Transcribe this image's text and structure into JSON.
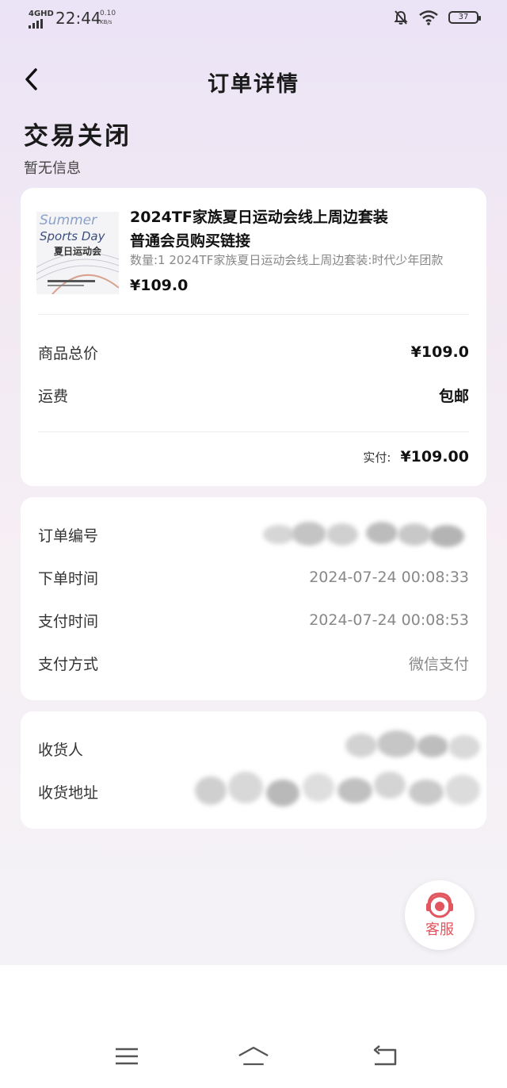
{
  "status_bar": {
    "network": "4GHD",
    "time": "22:44",
    "speed_value": "0.10",
    "speed_unit": "KB/s",
    "battery": "37",
    "icons": [
      "mute-bell-icon",
      "wifi-icon",
      "battery-icon"
    ]
  },
  "nav": {
    "title": "订单详情",
    "back_icon": "chevron-left-icon"
  },
  "order_status": {
    "title": "交易关闭",
    "subtitle": "暂无信息"
  },
  "goods": {
    "title_line1": "2024TF家族夏日运动会线上周边套装",
    "title_line2": "普通会员购买链接",
    "spec": "数量:1 2024TF家族夏日运动会线上周边套装:时代少年团款",
    "price": "¥109.0",
    "thumbnail_text": "Summer Sports Day",
    "thumbnail_subtext": "夏日运动会"
  },
  "price_summary": {
    "total_label": "商品总价",
    "total_value": "¥109.0",
    "shipping_label": "运费",
    "shipping_value": "包邮",
    "paid_label": "实付:",
    "paid_value": "¥109.00"
  },
  "order_info": {
    "number_label": "订单编号",
    "created_label": "下单时间",
    "created_value": "2024-07-24 00:08:33",
    "paid_time_label": "支付时间",
    "paid_time_value": "2024-07-24 00:08:53",
    "method_label": "支付方式",
    "method_value": "微信支付"
  },
  "address": {
    "receiver_label": "收货人",
    "address_label": "收货地址"
  },
  "service": {
    "label": "客服",
    "icon": "headset-icon",
    "color": "#e2565f"
  },
  "system_nav": {
    "icons": [
      "menu-icon",
      "home-icon",
      "back-icon"
    ]
  }
}
